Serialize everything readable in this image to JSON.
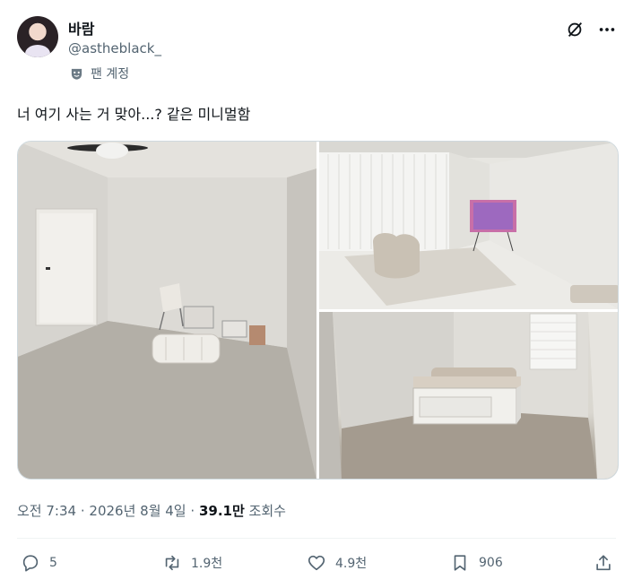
{
  "author": {
    "name": "바람",
    "handle": "@astheblack_",
    "badge_label": "팬 계정",
    "badge_icon": "mask-icon"
  },
  "header_icons": [
    "grok-icon",
    "more-icon"
  ],
  "tweet": {
    "text": "너 여기 사는 거 맞아...? 같은 미니멀함",
    "media_count": 3
  },
  "meta": {
    "time": "오전 7:34",
    "separator": "·",
    "date": "2026년 8월 4일",
    "views_value": "39.1만",
    "views_label": "조회수"
  },
  "actions": {
    "replies": "5",
    "reposts": "1.9천",
    "likes": "4.9천",
    "bookmarks": "906"
  },
  "colors": {
    "text": "#0f1419",
    "secondary": "#536471",
    "divider": "#eff3f4"
  }
}
